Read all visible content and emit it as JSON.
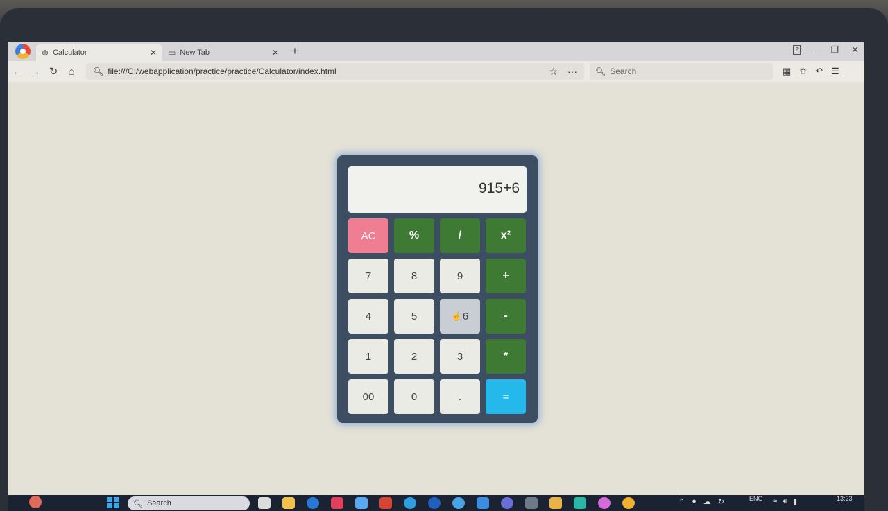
{
  "browser": {
    "tabs": [
      {
        "title": "Calculator",
        "icon": "globe-icon",
        "active": true
      },
      {
        "title": "New Tab",
        "icon": "newtab-icon",
        "active": false
      }
    ],
    "url": "file:///C:/webapplication/practice/practice/Calculator/index.html",
    "search_placeholder": "Search"
  },
  "calculator": {
    "display": "915+6",
    "keys": [
      {
        "label": "AC",
        "kind": "ac"
      },
      {
        "label": "%",
        "kind": "op"
      },
      {
        "label": "/",
        "kind": "op"
      },
      {
        "label": "x²",
        "kind": "op"
      },
      {
        "label": "7",
        "kind": "num"
      },
      {
        "label": "8",
        "kind": "num"
      },
      {
        "label": "9",
        "kind": "num"
      },
      {
        "label": "+",
        "kind": "op"
      },
      {
        "label": "4",
        "kind": "num"
      },
      {
        "label": "5",
        "kind": "num"
      },
      {
        "label": "6",
        "kind": "num",
        "hovered": true
      },
      {
        "label": "-",
        "kind": "op"
      },
      {
        "label": "1",
        "kind": "num"
      },
      {
        "label": "2",
        "kind": "num"
      },
      {
        "label": "3",
        "kind": "num"
      },
      {
        "label": "*",
        "kind": "op"
      },
      {
        "label": "00",
        "kind": "num"
      },
      {
        "label": "0",
        "kind": "num"
      },
      {
        "label": ".",
        "kind": "num"
      },
      {
        "label": "=",
        "kind": "eq"
      }
    ],
    "colors": {
      "ac": "#ef7e93",
      "op": "#3f7a34",
      "eq": "#25b8ea",
      "num": "#ebebe6",
      "body": "#3d4e63"
    }
  },
  "taskbar": {
    "search_label": "Search",
    "language": "ENG",
    "time": "13:23"
  }
}
